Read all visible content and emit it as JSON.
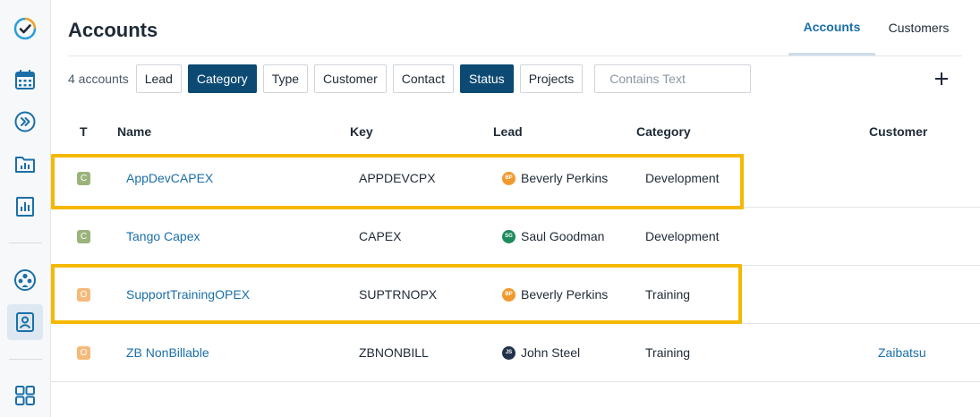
{
  "header": {
    "title": "Accounts",
    "tabs": [
      {
        "label": "Accounts",
        "active": true
      },
      {
        "label": "Customers",
        "active": false
      }
    ]
  },
  "filters": {
    "count_label": "4 accounts",
    "chips": [
      {
        "label": "Lead",
        "active": false
      },
      {
        "label": "Category",
        "active": true
      },
      {
        "label": "Type",
        "active": false
      },
      {
        "label": "Customer",
        "active": false
      },
      {
        "label": "Contact",
        "active": false
      },
      {
        "label": "Status",
        "active": true
      },
      {
        "label": "Projects",
        "active": false
      }
    ],
    "search_placeholder": "Contains Text"
  },
  "table": {
    "headers": {
      "type": "T",
      "name": "Name",
      "key": "Key",
      "lead": "Lead",
      "category": "Category",
      "customer": "Customer"
    },
    "rows": [
      {
        "type": "C",
        "type_color": "#9bb37a",
        "name": "AppDevCAPEX",
        "key": "APPDEVCPX",
        "lead_initials": "BP",
        "lead_color": "#f2992e",
        "lead": "Beverly Perkins",
        "category": "Development",
        "customer": "",
        "highlighted": true
      },
      {
        "type": "C",
        "type_color": "#9bb37a",
        "name": "Tango Capex",
        "key": "CAPEX",
        "lead_initials": "SG",
        "lead_color": "#1e8a5e",
        "lead": "Saul Goodman",
        "category": "Development",
        "customer": "",
        "highlighted": false
      },
      {
        "type": "O",
        "type_color": "#f5b97a",
        "name": "SupportTrainingOPEX",
        "key": "SUPTRNOPX",
        "lead_initials": "BP",
        "lead_color": "#f2992e",
        "lead": "Beverly Perkins",
        "category": "Training",
        "customer": "",
        "highlighted": true
      },
      {
        "type": "O",
        "type_color": "#f5b97a",
        "name": "ZB NonBillable",
        "key": "ZBNONBILL",
        "lead_initials": "JS",
        "lead_color": "#22324a",
        "lead": "John Steel",
        "category": "Training",
        "customer": "Zaibatsu",
        "highlighted": false
      }
    ]
  },
  "colors": {
    "accent": "#1b6fa8",
    "chip_active": "#0c4a73",
    "highlight": "#f5b800"
  },
  "sidebar": {
    "icons": [
      "app-logo-icon",
      "calendar-icon",
      "forward-icon",
      "folder-chart-icon",
      "report-chart-icon",
      "team-icon",
      "person-card-icon",
      "apps-grid-icon"
    ]
  }
}
